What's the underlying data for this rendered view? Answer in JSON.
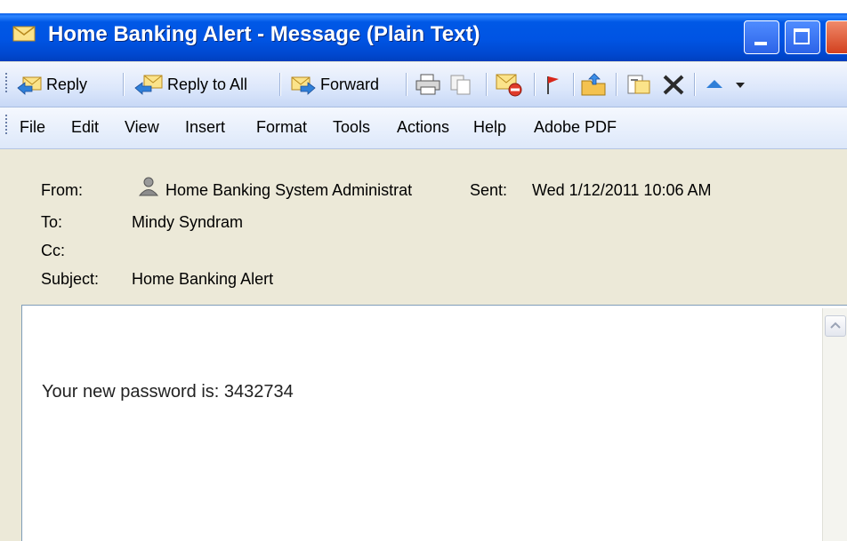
{
  "window": {
    "title": "Home Banking Alert - Message (Plain Text)"
  },
  "toolbar": {
    "reply": "Reply",
    "reply_all": "Reply to All",
    "forward": "Forward"
  },
  "menu": [
    "File",
    "Edit",
    "View",
    "Insert",
    "Format",
    "Tools",
    "Actions",
    "Help",
    "Adobe PDF"
  ],
  "header": {
    "from_label": "From:",
    "from_value": "Home Banking System Administrat",
    "sent_label": "Sent:",
    "sent_value": "Wed 1/12/2011 10:06 AM",
    "to_label": "To:",
    "to_value": "Mindy Syndram",
    "cc_label": "Cc:",
    "cc_value": "",
    "subject_label": "Subject:",
    "subject_value": "Home Banking Alert"
  },
  "body": {
    "text": "Your new password is: 3432734"
  },
  "colors": {
    "titlebar": "#0054e3",
    "toolbar": "#dce7fb",
    "header_bg": "#ece9d8",
    "close_button": "#d2401e"
  }
}
